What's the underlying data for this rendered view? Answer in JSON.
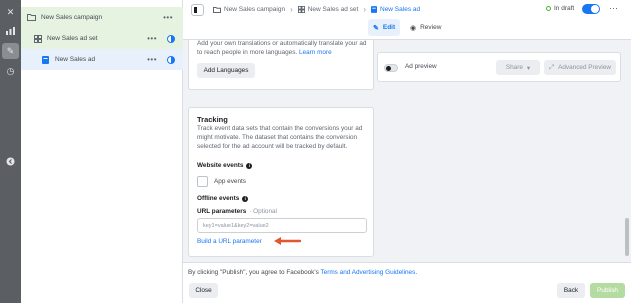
{
  "rail": {
    "items": [
      {
        "icon": "close-icon",
        "glyph": "✕"
      },
      {
        "icon": "chart-icon",
        "glyph": "▮"
      },
      {
        "icon": "pencil-icon",
        "glyph": "✎"
      },
      {
        "icon": "clock-icon",
        "glyph": "◷"
      },
      {
        "icon": "collapse-icon",
        "glyph": "‹"
      }
    ]
  },
  "tree": {
    "campaign": {
      "label": "New Sales campaign",
      "icon": "folder-icon"
    },
    "adset": {
      "label": "New Sales ad set",
      "icon": "grid-icon"
    },
    "ad": {
      "label": "New Sales ad",
      "icon": "ad-document-icon"
    }
  },
  "header": {
    "breadcrumbs": [
      "New Sales campaign",
      "New Sales ad set",
      "New Sales ad"
    ],
    "status": "In draft",
    "tabs": {
      "edit": "Edit",
      "review": "Review"
    }
  },
  "languages": {
    "text": "Add your own translations or automatically translate your ad to reach people in more languages.",
    "learn_more": "Learn more",
    "add_button": "Add Languages"
  },
  "tracking": {
    "title": "Tracking",
    "description": "Track event data sets that contain the conversions your ad might motivate. The dataset that contains the conversion selected for the ad account will be tracked by default.",
    "website_events": "Website events",
    "app_events": "App events",
    "offline_events": "Offline events",
    "url_params_label": "URL parameters",
    "url_params_optional": "· Optional",
    "url_params_placeholder": "key1=value1&key2=value2",
    "url_params_value": "",
    "build_link": "Build a URL parameter"
  },
  "preview": {
    "label": "Ad preview",
    "share": "Share",
    "advanced": "Advanced Preview"
  },
  "footer": {
    "note_prefix": "By clicking \"Publish\", you agree to Facebook's",
    "terms_link": "Terms and Advertising Guidelines",
    "note_suffix": ".",
    "close": "Close",
    "back": "Back",
    "publish": "Publish"
  },
  "colors": {
    "accent": "#1877f2",
    "annotation_arrow": "#e4572e",
    "publish_disabled": "#b5dba1"
  }
}
